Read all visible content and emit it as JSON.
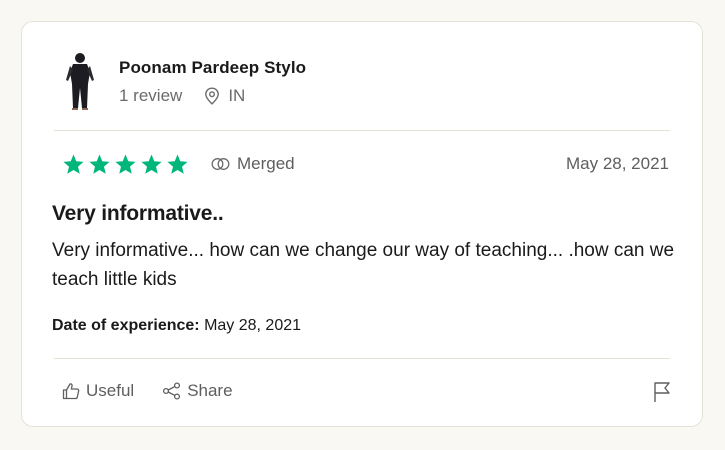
{
  "reviewer": {
    "name": "Poonam Pardeep Stylo",
    "reviews": "1 review",
    "country": "IN"
  },
  "rating": {
    "stars": 5,
    "max": 5,
    "star_color": "#00b67a",
    "merged_label": "Merged"
  },
  "date": "May 28, 2021",
  "review": {
    "title": "Very informative..",
    "body": "Very informative... how can we change our way of teaching... .how can we teach little kids"
  },
  "experience": {
    "label": "Date of experience:",
    "value": "May 28, 2021"
  },
  "actions": {
    "useful_label": "Useful",
    "share_label": "Share"
  },
  "icons": [
    "location-pin-icon",
    "merged-icon",
    "thumbs-up-icon",
    "share-icon",
    "flag-icon",
    "star-icon"
  ]
}
